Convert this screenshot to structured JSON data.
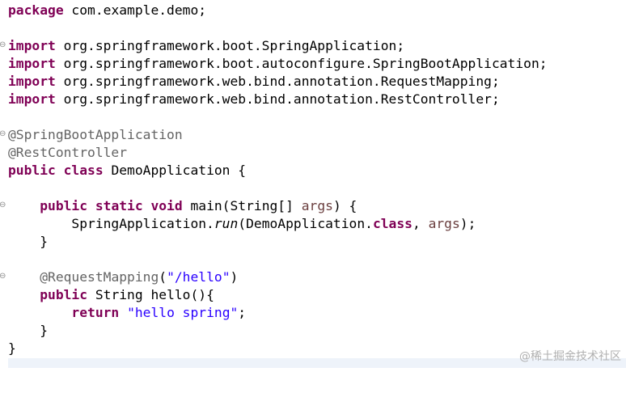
{
  "colors": {
    "keyword": "#7f0055",
    "annotation": "#646464",
    "string": "#2a00ff",
    "parameter": "#6a3e3e",
    "text": "#000000",
    "background": "#ffffff"
  },
  "icons": {
    "fold_marker": "fold-collapse-icon"
  },
  "code": {
    "l1": {
      "kw": "package",
      "rest": " com.example.demo;"
    },
    "l3": {
      "kw": "import",
      "rest": " org.springframework.boot.SpringApplication;"
    },
    "l4": {
      "kw": "import",
      "rest": " org.springframework.boot.autoconfigure.SpringBootApplication;"
    },
    "l5": {
      "kw": "import",
      "rest": " org.springframework.web.bind.annotation.RequestMapping;"
    },
    "l6": {
      "kw": "import",
      "rest": " org.springframework.web.bind.annotation.RestController;"
    },
    "l8": {
      "ann": "@SpringBootApplication"
    },
    "l9": {
      "ann": "@RestController"
    },
    "l10": {
      "kw": "public class",
      "rest": " DemoApplication {"
    },
    "l12": {
      "indent": "    ",
      "kw": "public static void",
      "rest": " main(String[] ",
      "param": "args",
      "end": ") {"
    },
    "l13": {
      "indent": "        ",
      "a": "SpringApplication.",
      "run": "run",
      "b": "(DemoApplication.",
      "kw": "class",
      "c": ", ",
      "param": "args",
      "d": ");"
    },
    "l14": {
      "text": "    }"
    },
    "l16": {
      "indent": "    ",
      "ann": "@RequestMapping",
      "open": "(",
      "str": "\"/hello\"",
      "close": ")"
    },
    "l17": {
      "indent": "    ",
      "kw": "public",
      "rest": " String hello(){"
    },
    "l18": {
      "indent": "        ",
      "kw": "return",
      "sp": " ",
      "str": "\"hello spring\"",
      "end": ";"
    },
    "l19": {
      "text": "    }"
    },
    "l20": {
      "text": "}"
    }
  },
  "watermark": "@稀土掘金技术社区"
}
